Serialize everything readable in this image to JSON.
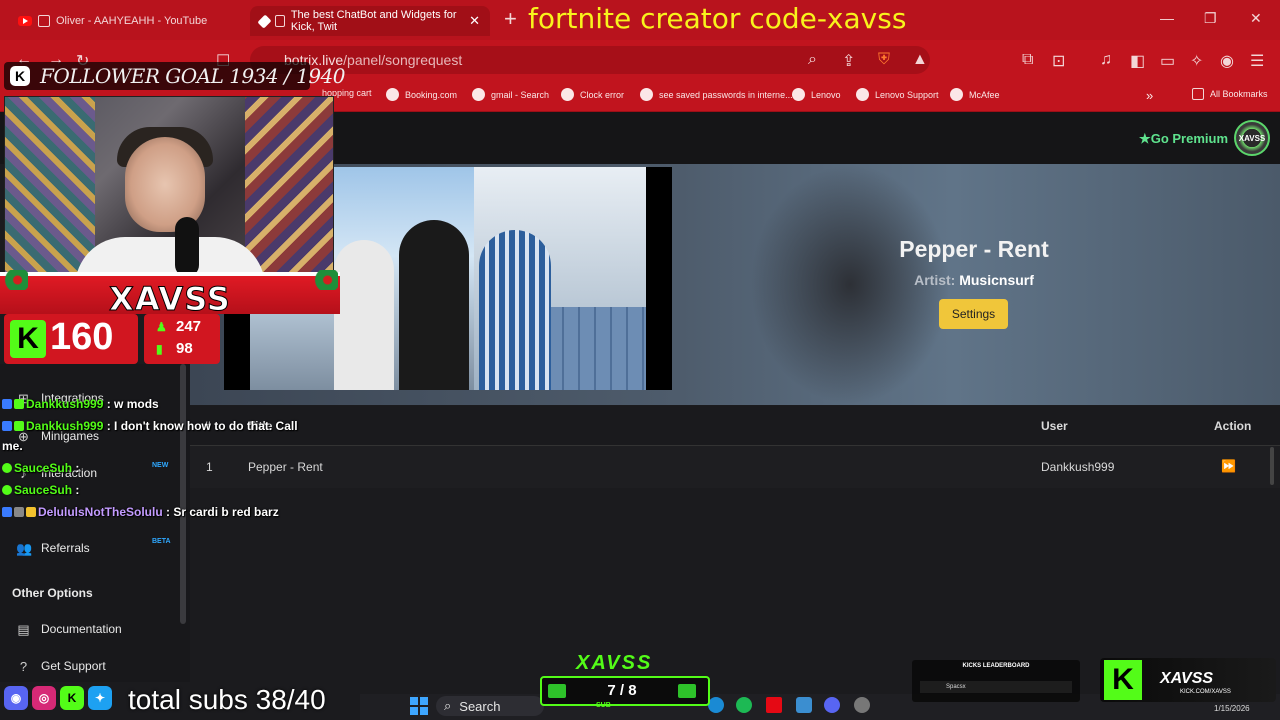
{
  "browser": {
    "tabs": [
      {
        "title": "Oliver - AAHYEAHH - YouTube"
      },
      {
        "title": "The best ChatBot and Widgets for Kick, Twit"
      }
    ],
    "url_host": "botrix.live",
    "url_path": "/panel/songrequest",
    "bookmarks": [
      "hopping cart",
      "Booking.com",
      "gmail - Search",
      "Clock error",
      "see saved passwords in interne...",
      "Lenovo",
      "Lenovo Support",
      "McAfee"
    ],
    "all_bookmarks": "All Bookmarks"
  },
  "overlay": {
    "title": "fortnite creator code-xavss",
    "follower_goal": "FOLLOWER GOAL 1934 / 1940",
    "streamer_name": "XAVSS",
    "viewers": "160",
    "stat_followers": "247",
    "stat_chart": "98",
    "total_subs": "total subs 38/40",
    "sub_goal_logo": "XAVSS",
    "sub_goal_count": "7 / 8",
    "sub_goal_label": "SUB",
    "kicks_title": "KICKS LEADERBOARD",
    "kicks_row": "Spacsx",
    "brand_name": "XAVSS",
    "brand_url": "KICK.COM/XAVSS"
  },
  "chat": [
    {
      "user": "Dankkush999",
      "text": ": w mods"
    },
    {
      "user": "Dankkush999",
      "text": ": I don't know how to do that. Call"
    },
    {
      "user": "",
      "text": "me."
    },
    {
      "user": "SauceSuh",
      "text": ":"
    },
    {
      "user": "SauceSuh",
      "text": ":"
    },
    {
      "user": "DelululsNotTheSolulu",
      "text": ": Sr cardi b red barz"
    }
  ],
  "page": {
    "go_premium": "Go Premium",
    "avatar_label": "XAVSS",
    "song_title": "Pepper - Rent",
    "artist_label": "Artist:",
    "artist_name": "Musicnsurf",
    "settings_label": "Settings",
    "table": {
      "columns": [
        "#",
        "Title",
        "User",
        "Action"
      ],
      "rows": [
        {
          "num": "1",
          "title": "Pepper - Rent",
          "user": "Dankkush999"
        }
      ]
    }
  },
  "sidebar": {
    "items": [
      {
        "label": "Integrations"
      },
      {
        "label": "Minigames"
      },
      {
        "label": "Interaction",
        "badge": "NEW"
      },
      {
        "label": "Referrals",
        "badge": "BETA"
      }
    ],
    "other_options": "Other Options",
    "documentation": "Documentation",
    "get_support": "Get Support"
  },
  "taskbar": {
    "search": "Search",
    "date": "1/15/2026"
  },
  "colors": {
    "browser_red": "#c1141e",
    "kick_green": "#53fc18",
    "settings_yellow": "#f0c63a",
    "overlay_title": "#f8f31c"
  }
}
